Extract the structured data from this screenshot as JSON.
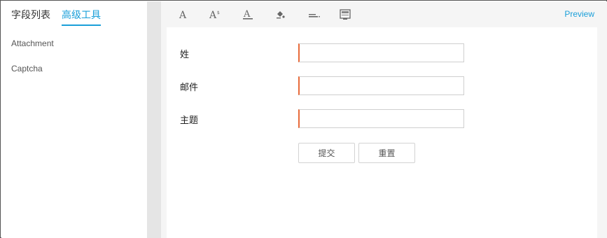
{
  "sidebar": {
    "tabs": [
      {
        "label": "字段列表"
      },
      {
        "label": "高级工具"
      }
    ],
    "items": [
      {
        "label": "Attachment"
      },
      {
        "label": "Captcha"
      }
    ]
  },
  "toolbar": {
    "icons": [
      "font-icon",
      "font-size-icon",
      "font-color-icon",
      "background-fill-icon",
      "line-spacing-icon",
      "layout-icon"
    ],
    "preview_label": "Preview"
  },
  "form": {
    "fields": [
      {
        "label": "姓",
        "value": ""
      },
      {
        "label": "邮件",
        "value": ""
      },
      {
        "label": "主题",
        "value": ""
      }
    ],
    "submit_label": "提交",
    "reset_label": "重置"
  },
  "colors": {
    "accent": "#1a9fd9",
    "required_marker": "#e86a3a"
  }
}
